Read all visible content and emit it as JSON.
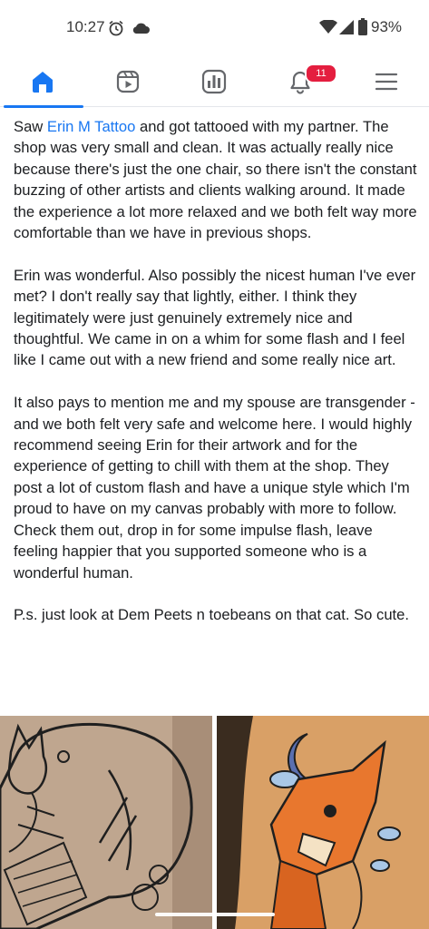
{
  "status_bar": {
    "time": "10:27",
    "battery": "93%",
    "icons": [
      "alarm-icon",
      "cloud-icon",
      "wifi-icon",
      "signal-icon",
      "battery-icon"
    ]
  },
  "nav": {
    "items": [
      {
        "name": "home",
        "icon": "home-icon",
        "active": true
      },
      {
        "name": "video",
        "icon": "video-icon",
        "active": false
      },
      {
        "name": "marketplace",
        "icon": "marketplace-icon",
        "active": false
      },
      {
        "name": "notifications",
        "icon": "bell-icon",
        "badge": "11"
      },
      {
        "name": "menu",
        "icon": "menu-icon",
        "active": false
      }
    ],
    "accent_color": "#1877f2",
    "badge_color": "#e41e3f"
  },
  "post": {
    "p1_prefix": "Saw ",
    "p1_mention": "Erin M Tattoo",
    "p1_rest": " and got tattooed with my partner. The shop was very small and clean. It was actually really nice because there's just the one chair, so there isn't the constant buzzing of other artists and clients walking around. It made the experience a lot more relaxed and we both felt way more comfortable than we have in previous shops.",
    "p2": "Erin was wonderful. Also possibly the nicest human I've ever met? I don't really say that lightly, either. I think they legitimately were just genuinely extremely nice and thoughtful. We came in on a whim for some flash and I feel like I came out with a new friend and some really nice art.",
    "p3": "It also pays to mention me and my spouse are transgender - and we both felt very safe and welcome here. I would highly recommend seeing Erin for their artwork and for the experience of getting to chill with them at the shop. They post a lot of custom flash and have a unique style which I'm proud to have on my canvas probably with more to follow. Check them out, drop in for some impulse flash, leave feeling happier that you supported someone who is a wonderful human.",
    "p4": "P.s. just look at Dem Peets n toebeans on that cat. So cute."
  },
  "photos": [
    {
      "subject": "line-work cat tattoo on skin"
    },
    {
      "subject": "colored fox and moon tattoo on leg"
    }
  ]
}
